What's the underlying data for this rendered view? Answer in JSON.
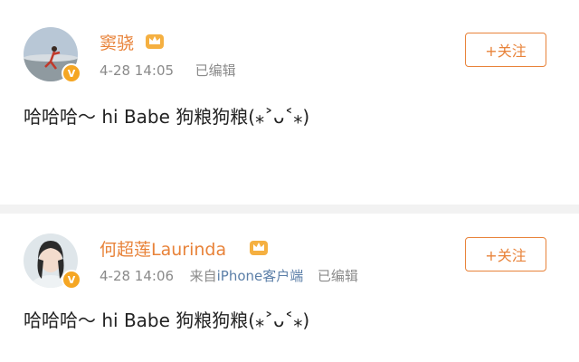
{
  "posts": [
    {
      "username": "窦骁",
      "timestamp": "4-28 14:05",
      "source": "",
      "edited": "已编辑",
      "follow_label": "+关注",
      "content": "哈哈哈～ hi Babe 狗粮狗粮(⁎˃ᴗ˂⁎)",
      "verified_badge": "V"
    },
    {
      "username": "何超莲Laurinda",
      "timestamp": "4-28 14:06",
      "source_prefix": "来自",
      "source": "iPhone客户端",
      "edited": "已编辑",
      "follow_label": "+关注",
      "content": "哈哈哈～ hi Babe 狗粮狗粮(⁎˃ᴗ˂⁎)",
      "verified_badge": "V"
    }
  ],
  "colors": {
    "accent": "#e8833a",
    "badge": "#f5a623",
    "meta": "#8a8a8a",
    "link": "#5c7fa8"
  }
}
